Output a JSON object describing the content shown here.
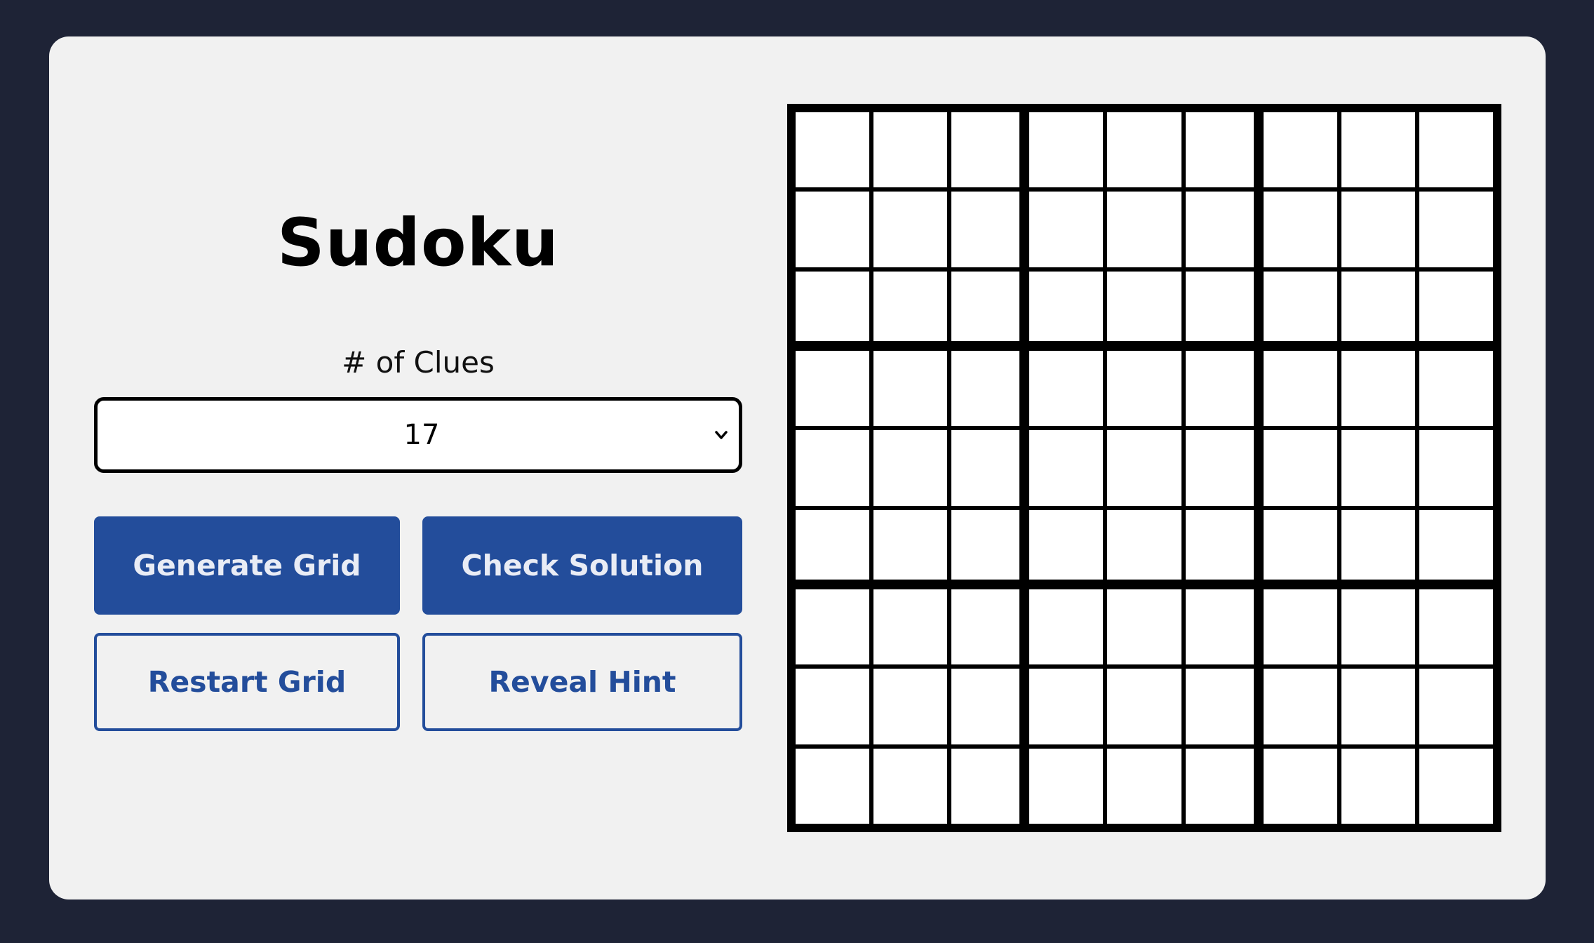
{
  "app": {
    "title": "Sudoku"
  },
  "controls": {
    "clues_label": "# of Clues",
    "clues_selected": "17",
    "buttons": {
      "generate": "Generate Grid",
      "check": "Check Solution",
      "restart": "Restart Grid",
      "hint": "Reveal Hint"
    }
  },
  "colors": {
    "background": "#1e2336",
    "card": "#f1f1f1",
    "accent": "#234d9b"
  },
  "icons": {
    "select": "chevron-down-icon"
  },
  "board": {
    "rows": 9,
    "cols": 9,
    "values": [
      [
        "",
        "",
        "",
        "",
        "",
        "",
        "",
        "",
        ""
      ],
      [
        "",
        "",
        "",
        "",
        "",
        "",
        "",
        "",
        ""
      ],
      [
        "",
        "",
        "",
        "",
        "",
        "",
        "",
        "",
        ""
      ],
      [
        "",
        "",
        "",
        "",
        "",
        "",
        "",
        "",
        ""
      ],
      [
        "",
        "",
        "",
        "",
        "",
        "",
        "",
        "",
        ""
      ],
      [
        "",
        "",
        "",
        "",
        "",
        "",
        "",
        "",
        ""
      ],
      [
        "",
        "",
        "",
        "",
        "",
        "",
        "",
        "",
        ""
      ],
      [
        "",
        "",
        "",
        "",
        "",
        "",
        "",
        "",
        ""
      ],
      [
        "",
        "",
        "",
        "",
        "",
        "",
        "",
        "",
        ""
      ]
    ]
  }
}
